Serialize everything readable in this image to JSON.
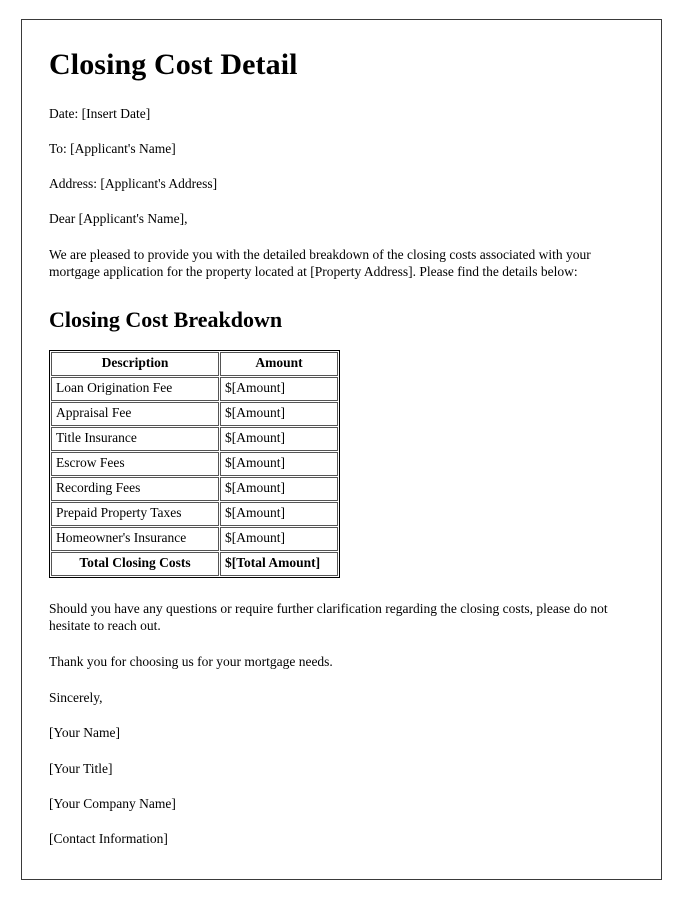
{
  "document": {
    "title": "Closing Cost Detail",
    "meta": [
      {
        "name": "date-line",
        "text": "Date: [Insert Date]"
      },
      {
        "name": "recipient-line",
        "text": "To: [Applicant's Name]"
      },
      {
        "name": "address-line",
        "text": "Address: [Applicant's Address]"
      }
    ],
    "salutation": "Dear [Applicant's Name],",
    "intro_paragraph": "We are pleased to provide you with the detailed breakdown of the closing costs associated with your mortgage application for the property located at [Property Address]. Please find the details below:",
    "section_title": "Closing Cost Breakdown",
    "table": {
      "headers": [
        "Description",
        "Amount"
      ],
      "rows": [
        [
          "Loan Origination Fee",
          "$[Amount]"
        ],
        [
          "Appraisal Fee",
          "$[Amount]"
        ],
        [
          "Title Insurance",
          "$[Amount]"
        ],
        [
          "Escrow Fees",
          "$[Amount]"
        ],
        [
          "Recording Fees",
          "$[Amount]"
        ],
        [
          "Prepaid Property Taxes",
          "$[Amount]"
        ],
        [
          "Homeowner's Insurance",
          "$[Amount]"
        ]
      ],
      "total_row": [
        "Total Closing Costs",
        "$[Total Amount]"
      ]
    },
    "closing_paragraph": "Should you have any questions or require further clarification regarding the closing costs, please do not hesitate to reach out.",
    "thanks_paragraph": "Thank you for choosing us for your mortgage needs.",
    "signoff": "Sincerely,",
    "signature": [
      {
        "name": "your-name",
        "text": "[Your Name]"
      },
      {
        "name": "your-title",
        "text": "[Your Title]"
      },
      {
        "name": "your-company-name",
        "text": "[Your Company Name]"
      },
      {
        "name": "contact-information",
        "text": "[Contact Information]"
      }
    ]
  }
}
